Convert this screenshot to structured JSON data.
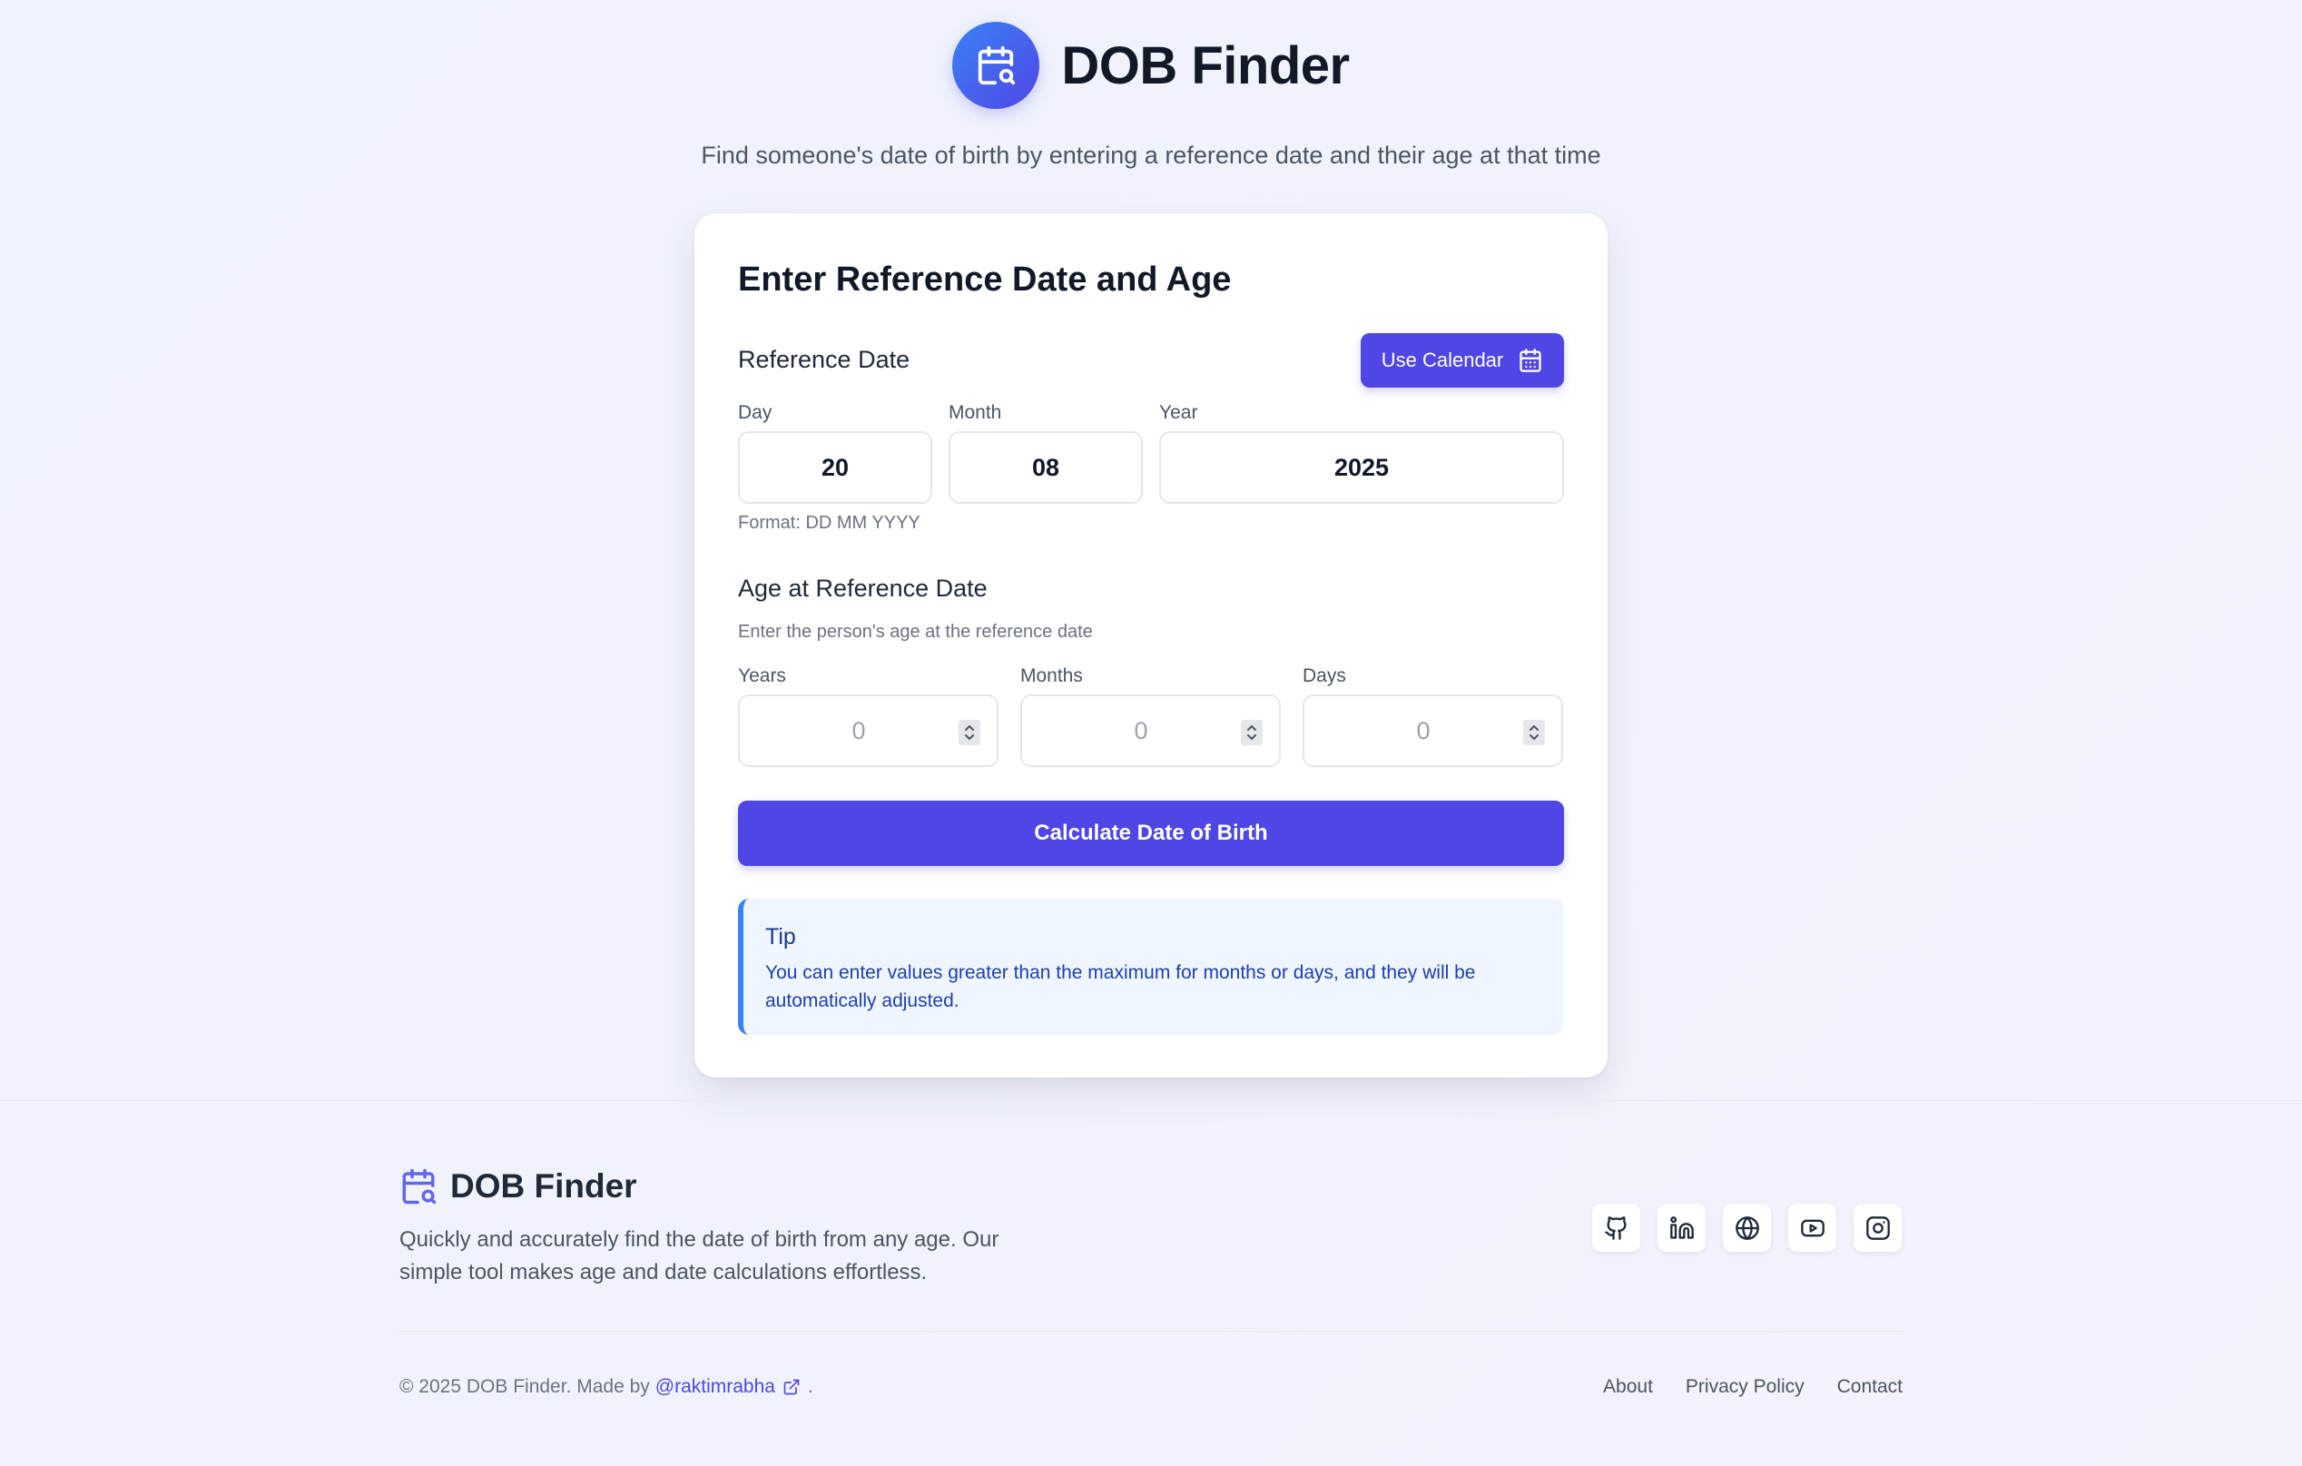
{
  "header": {
    "title": "DOB Finder",
    "subtitle": "Find someone's date of birth by entering a reference date and their age at that time",
    "logo_icon": "calendar-search-icon"
  },
  "card": {
    "title": "Enter Reference Date and Age",
    "reference_date": {
      "label": "Reference Date",
      "use_calendar_label": "Use Calendar",
      "day_label": "Day",
      "month_label": "Month",
      "year_label": "Year",
      "day_value": "20",
      "month_value": "08",
      "year_value": "2025",
      "format_hint": "Format: DD MM YYYY"
    },
    "age": {
      "label": "Age at Reference Date",
      "hint": "Enter the person's age at the reference date",
      "years_label": "Years",
      "months_label": "Months",
      "days_label": "Days",
      "years_placeholder": "0",
      "months_placeholder": "0",
      "days_placeholder": "0"
    },
    "calculate_label": "Calculate Date of Birth",
    "tip": {
      "title": "Tip",
      "text": "You can enter values greater than the maximum for months or days, and they will be automatically adjusted."
    }
  },
  "footer": {
    "brand_title": "DOB Finder",
    "description": "Quickly and accurately find the date of birth from any age. Our simple tool makes age and date calculations effortless.",
    "socials": [
      "github-icon",
      "linkedin-icon",
      "globe-icon",
      "youtube-icon",
      "instagram-icon"
    ],
    "copyright_prefix": "© 2025 DOB Finder. Made by",
    "author_handle": "@raktimrabha",
    "copyright_suffix": ".",
    "links": [
      "About",
      "Privacy Policy",
      "Contact"
    ]
  },
  "colors": {
    "accent": "#4f46e5",
    "accent_light": "#3b82f6",
    "tip_bg": "#eff6ff",
    "text_dark": "#111827"
  }
}
